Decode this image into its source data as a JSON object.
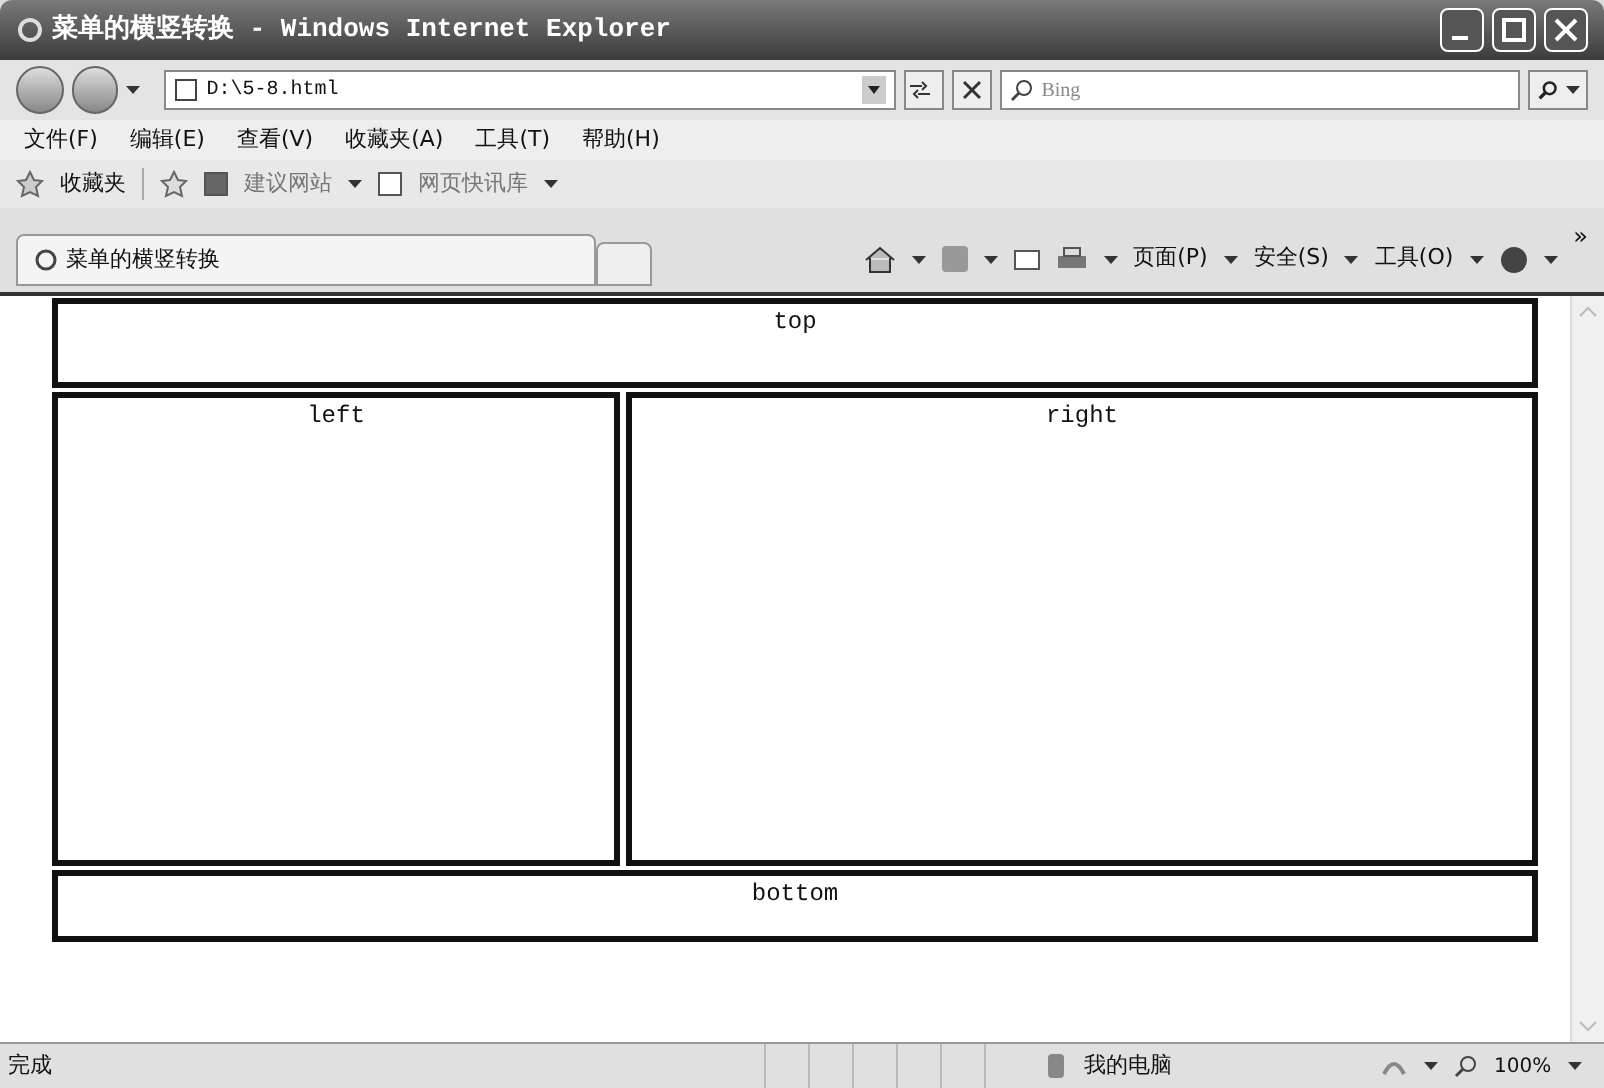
{
  "window": {
    "title": "菜单的横竖转换 - Windows Internet Explorer"
  },
  "address_bar": {
    "url": "D:\\5-8.html"
  },
  "search": {
    "placeholder": "Bing"
  },
  "menu": [
    "文件(F)",
    "编辑(E)",
    "查看(V)",
    "收藏夹(A)",
    "工具(T)",
    "帮助(H)"
  ],
  "favorites_bar": {
    "label": "收藏夹",
    "links": [
      "建议网站",
      "网页快讯库"
    ]
  },
  "tabs": [
    {
      "label": "菜单的横竖转换",
      "selected": true
    }
  ],
  "command_bar": {
    "items": [
      "页面(P)",
      "安全(S)",
      "工具(O)"
    ],
    "overflow": "»"
  },
  "frames": {
    "top": "top",
    "left": "left",
    "right": "right",
    "bottom": "bottom"
  },
  "status_bar": {
    "text": "完成",
    "zone": "我的电脑",
    "zoom": "100%"
  }
}
